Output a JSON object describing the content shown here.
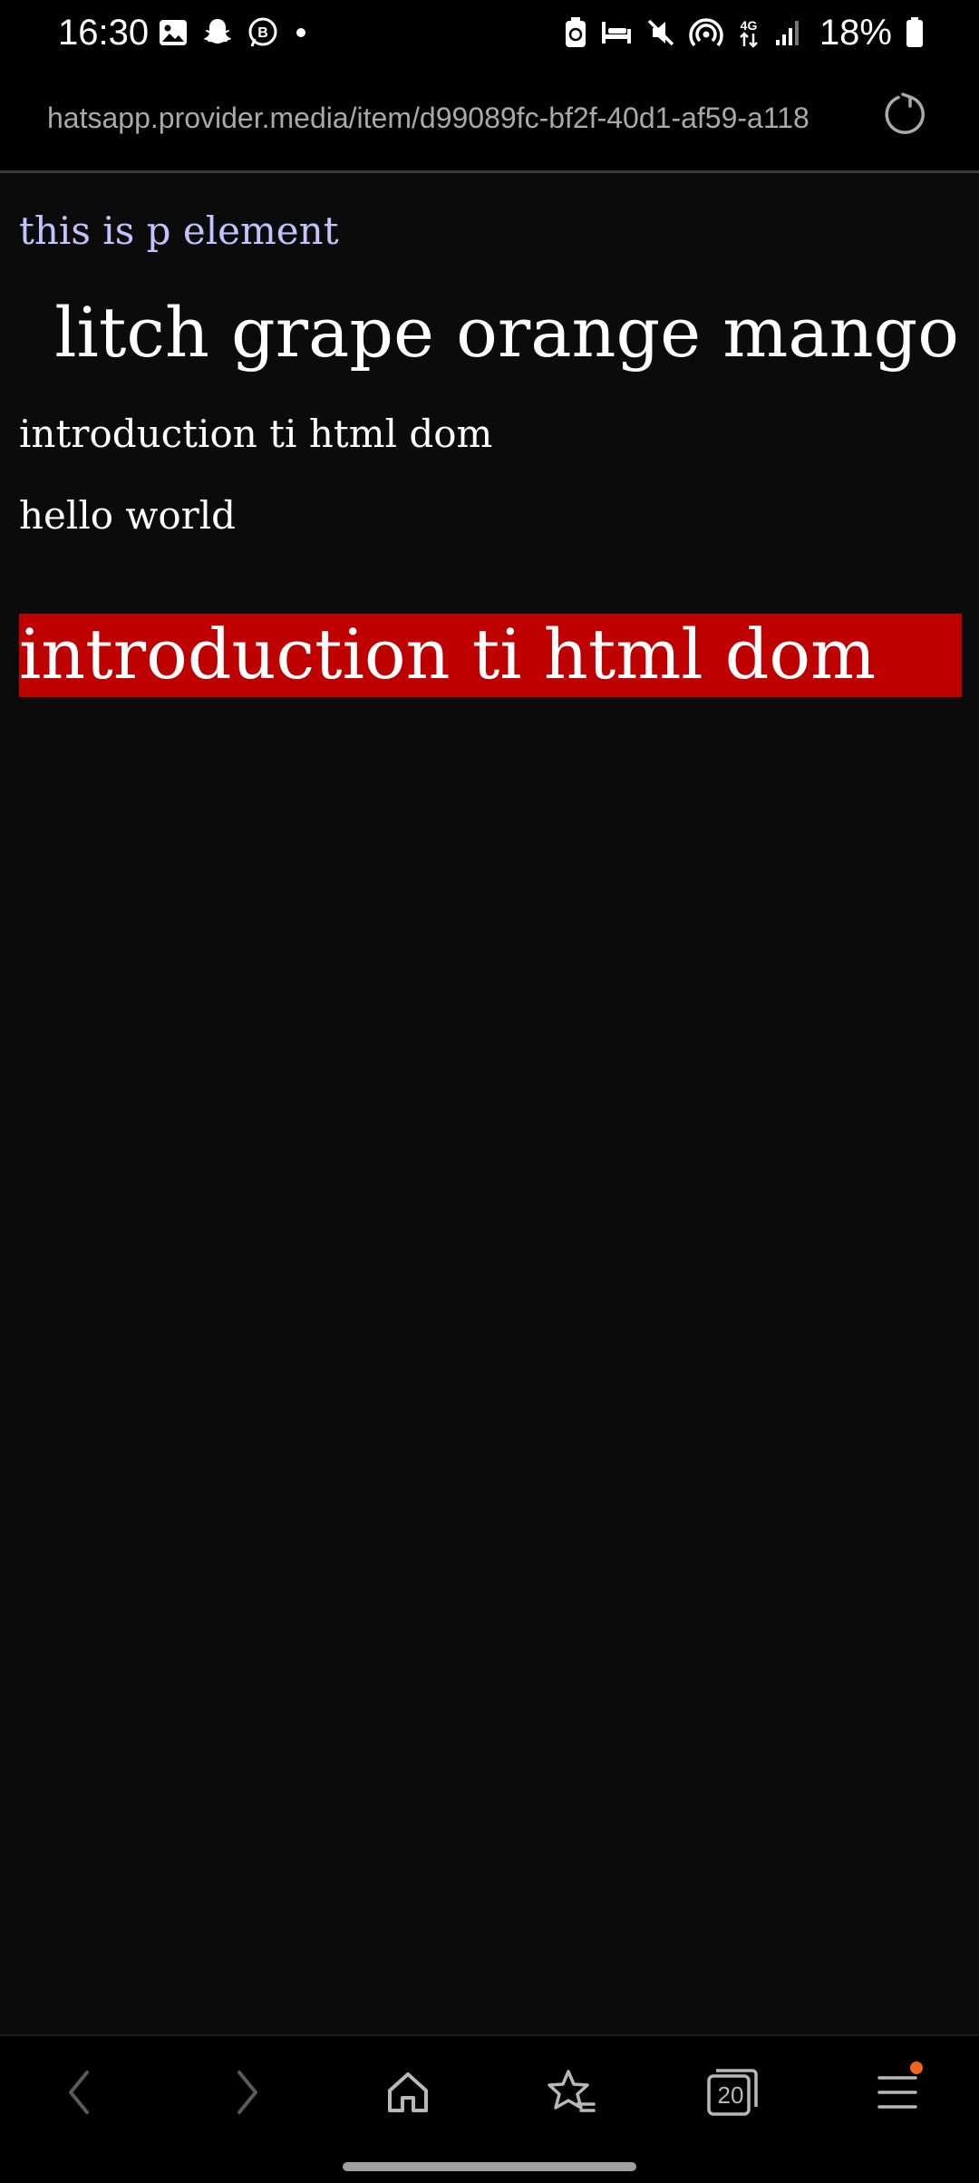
{
  "status_bar": {
    "time": "16:30",
    "battery_text": "18%",
    "left_icons": [
      "gallery-icon",
      "snapchat-icon",
      "whatsapp-business-icon",
      "dot-icon"
    ],
    "right_icons": [
      "battery-saver-icon",
      "sleep-mode-icon",
      "mute-icon",
      "hotspot-icon",
      "4g-data-icon",
      "signal-icon",
      "battery-icon"
    ]
  },
  "browser": {
    "url": "hatsapp.provider.media/item/d99089fc-bf2f-40d1-af59-a118"
  },
  "page": {
    "p_element": "this is p element",
    "fruits_heading": "litch grape orange mango",
    "intro_text": "introduction ti html dom",
    "hello_text": "hello world",
    "intro_highlight": "introduction ti html dom"
  },
  "bottom_nav": {
    "tabs_count": "20",
    "items": [
      "back-icon",
      "forward-icon",
      "home-icon",
      "bookmarks-icon",
      "tabs-icon",
      "menu-icon"
    ]
  },
  "colors": {
    "background": "#0b0b0b",
    "bar_background": "#000000",
    "p_element_text": "#c5c1ff",
    "highlight_background": "#be0000",
    "menu_notification_dot": "#f26322"
  }
}
